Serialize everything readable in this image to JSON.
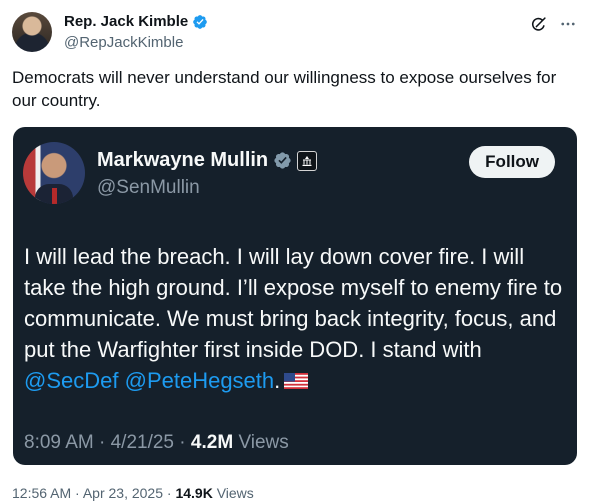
{
  "author": {
    "name": "Rep. Jack Kimble",
    "handle": "@RepJackKimble"
  },
  "tweet": {
    "text": "Democrats will never understand our willingness to expose ourselves for our country."
  },
  "quoted": {
    "name": "Markwayne Mullin",
    "handle": "@SenMullin",
    "follow_label": "Follow",
    "text_before": "I will lead the breach. I will lay down cover fire. I will take the high ground. I’ll expose myself to enemy fire to communicate. We must bring back integrity, focus, and put the Warfighter first inside DOD. I stand with ",
    "mention1": "@SecDef",
    "mention2": "@PeteHegseth",
    "text_after": ".",
    "time": "8:09 AM",
    "date": "4/21/25",
    "views_count": "4.2M",
    "views_label": "Views"
  },
  "meta": {
    "time": "12:56 AM",
    "date": "Apr 23, 2025",
    "views_count": "14.9K",
    "views_label": "Views"
  },
  "colors": {
    "accent": "#1d9bf0",
    "card_bg": "#15202b"
  },
  "icons": [
    "verified-badge-icon",
    "grok-icon",
    "more-icon",
    "government-badge-icon",
    "us-flag-icon"
  ]
}
